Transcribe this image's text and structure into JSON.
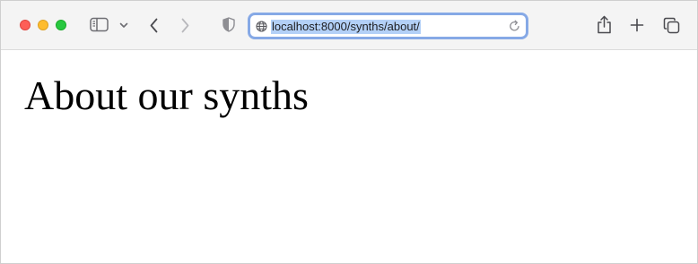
{
  "browser": {
    "address_bar": {
      "url": "localhost:8000/synths/about/"
    }
  },
  "page": {
    "heading": "About our synths"
  },
  "icons": {
    "window_close": "close-circle",
    "window_minimize": "minimize-circle",
    "window_maximize": "maximize-circle",
    "sidebar": "sidebar-icon",
    "sidebar_menu": "chevron-down-icon",
    "back": "chevron-left-icon",
    "forward": "chevron-right-icon",
    "privacy": "shield-icon",
    "site": "globe-icon",
    "reload": "reload-icon",
    "share": "share-icon",
    "new_tab": "plus-icon",
    "tab_overview": "tabs-overview-icon"
  },
  "colors": {
    "close": "#fe5f57",
    "minimize": "#febc2e",
    "maximize": "#28c840",
    "address_focus_ring": "#86a9e6",
    "url_selection": "#b3d0f7"
  }
}
